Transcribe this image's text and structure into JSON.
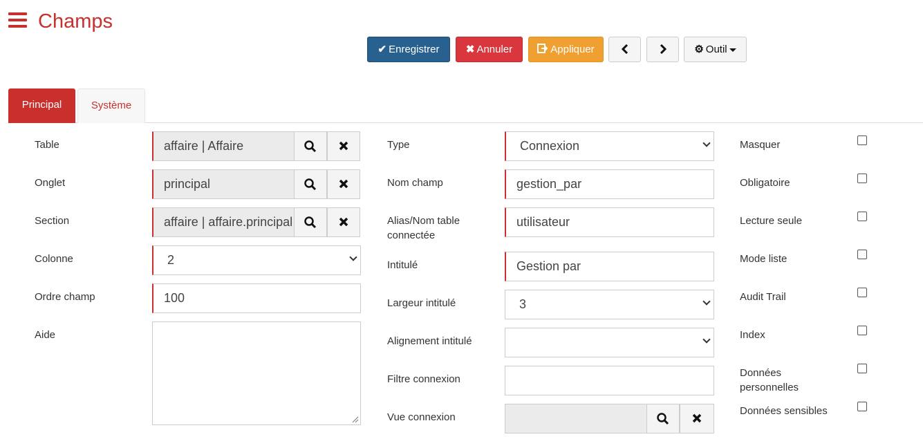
{
  "header": {
    "title": "Champs"
  },
  "toolbar": {
    "save_label": "Enregistrer",
    "cancel_label": "Annuler",
    "apply_label": "Appliquer",
    "tool_label": "Outil"
  },
  "tabs": [
    {
      "label": "Principal",
      "active": true
    },
    {
      "label": "Système",
      "active": false
    }
  ],
  "left_column": {
    "table": {
      "label": "Table",
      "value": "affaire | Affaire"
    },
    "onglet": {
      "label": "Onglet",
      "value": "principal"
    },
    "section": {
      "label": "Section",
      "value": "affaire | affaire.principal"
    },
    "colonne": {
      "label": "Colonne",
      "value": "2"
    },
    "ordre": {
      "label": "Ordre champ",
      "value": "100"
    },
    "aide": {
      "label": "Aide",
      "value": ""
    }
  },
  "middle_column": {
    "type": {
      "label": "Type",
      "value": "Connexion"
    },
    "nom_champ": {
      "label": "Nom champ",
      "value": "gestion_par"
    },
    "alias": {
      "label_line1": "Alias/Nom table",
      "label_line2": "connectée",
      "value": "utilisateur"
    },
    "intitule": {
      "label": "Intitulé",
      "value": "Gestion par"
    },
    "largeur": {
      "label": "Largeur intitulé",
      "value": "3"
    },
    "alignement": {
      "label": "Alignement intitulé",
      "value": ""
    },
    "filtre": {
      "label": "Filtre connexion",
      "value": ""
    },
    "vue": {
      "label": "Vue connexion",
      "value": ""
    }
  },
  "right_column": {
    "masquer": {
      "label": "Masquer",
      "checked": false
    },
    "obligatoire": {
      "label": "Obligatoire",
      "checked": false
    },
    "lecture_seule": {
      "label": "Lecture seule",
      "checked": false
    },
    "mode_liste": {
      "label": "Mode liste",
      "checked": false
    },
    "audit_trail": {
      "label": "Audit Trail",
      "checked": false
    },
    "index": {
      "label": "Index",
      "checked": false
    },
    "donnees_perso": {
      "label_line1": "Données",
      "label_line2": "personnelles",
      "checked": false
    },
    "donnees_sensibles": {
      "label": "Données sensibles",
      "checked": false
    }
  },
  "colors": {
    "accent": "#c9302c",
    "primary": "#286090",
    "danger": "#d9363e",
    "warning": "#f0a030"
  },
  "icons": [
    "menu-icon",
    "check-icon",
    "times-icon",
    "share-icon",
    "chevron-left-icon",
    "chevron-right-icon",
    "gear-icon",
    "search-icon",
    "close-icon",
    "chevron-down-icon"
  ]
}
